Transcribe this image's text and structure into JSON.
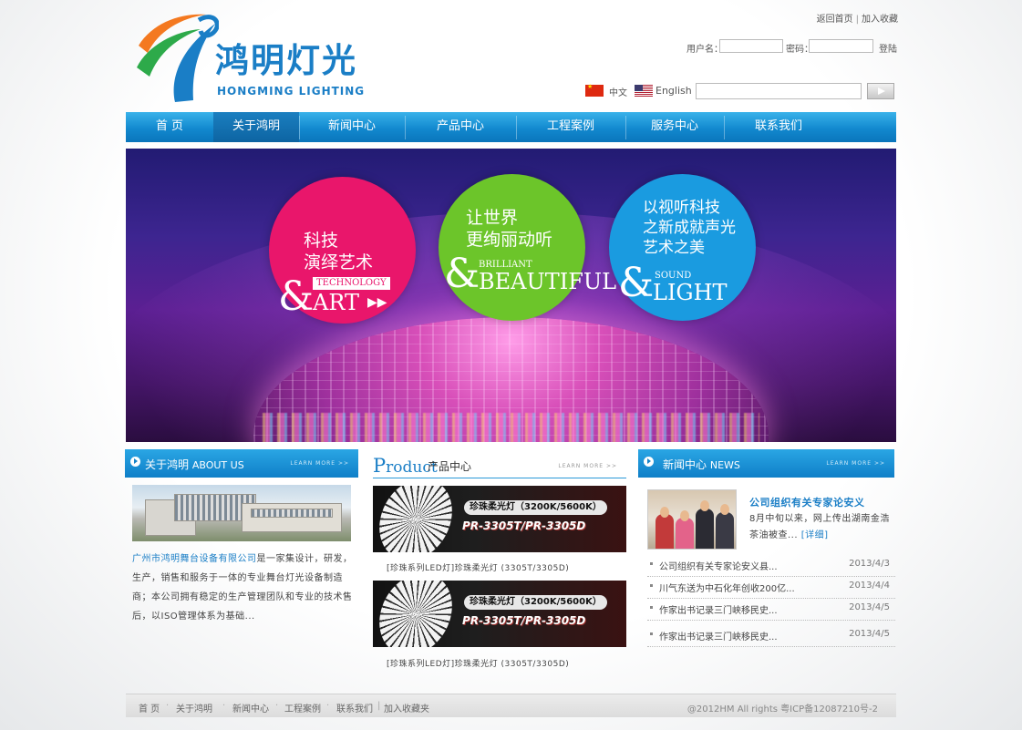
{
  "brand": {
    "name_cn": "鸿明灯光",
    "name_en": "HONGMING LIGHTING"
  },
  "toplinks": {
    "home": "返回首页",
    "bookmark": "加入收藏"
  },
  "login": {
    "username_label": "用户名：",
    "password_label": "密码：",
    "login_button": "登陆",
    "username_value": "",
    "password_value": ""
  },
  "lang": {
    "chinese": "中文",
    "english": "English"
  },
  "search": {
    "value": ""
  },
  "nav": {
    "items": [
      "首 页",
      "关于鸿明",
      "新闻中心",
      "产品中心",
      "工程案例",
      "服务中心",
      "联系我们"
    ],
    "active": "关于鸿明"
  },
  "banner": {
    "circle1": {
      "cn1": "科技",
      "cn2": "演绎艺术",
      "tag": "TECHNOLOGY",
      "big": "ART"
    },
    "circle2": {
      "cn1": "让世界",
      "cn2": "更绚丽动听",
      "small": "BRILLIANT",
      "big": "BEAUTIFUL"
    },
    "circle3": {
      "cn1": "以视听科技",
      "cn2": "之新成就声光",
      "cn3": "艺术之美",
      "small": "SOUND",
      "big": "LIGHT"
    },
    "amp": "&"
  },
  "about": {
    "title_cn": "关于鸿明",
    "title_en": "ABOUT US",
    "more": "LEARN MORE >>",
    "company": "广州市鸿明舞台设备有限公司",
    "text": "是一家集设计，研发，生产，销售和服务于一体的专业舞台灯光设备制造商；本公司拥有稳定的生产管理团队和专业的技术售后，以ISO管理体系为基础..."
  },
  "product": {
    "title_en_first": "P",
    "title_en_rest": "roduct",
    "title_cn": "产品中心",
    "more": "LEARN MORE >>",
    "items": [
      {
        "label1": "珍珠柔光灯（3200K/5600K）",
        "label2": "PR-3305T/PR-3305D",
        "caption": "[珍珠系列LED灯]珍珠柔光灯 (3305T/3305D)"
      },
      {
        "label1": "珍珠柔光灯（3200K/5600K）",
        "label2": "PR-3305T/PR-3305D",
        "caption": "[珍珠系列LED灯]珍珠柔光灯 (3305T/3305D)"
      }
    ]
  },
  "news": {
    "title_cn": "新闻中心",
    "title_en": "NEWS",
    "more": "LEARN MORE >>",
    "featured_title": "公司组织有关专家论安义",
    "featured_summary": "8月中旬以来，网上传出湖南金浩茶油被查...",
    "detail": "[详细]",
    "rows": [
      {
        "title": "公司组织有关专家论安义县...",
        "date": "2013/4/3"
      },
      {
        "title": "川气东送为中石化年创收200亿...",
        "date": "2013/4/4"
      },
      {
        "title": "作家出书记录三门峡移民史...",
        "date": "2013/4/5"
      },
      {
        "title": "作家出书记录三门峡移民史...",
        "date": "2013/4/5"
      }
    ]
  },
  "footer": {
    "links": [
      "首 页",
      "关于鸿明",
      "新闻中心",
      "工程案例",
      "联系我们",
      "加入收藏夹"
    ],
    "copyright": "@2012HM All rights 粤ICP备12087210号-2"
  },
  "colors": {
    "brand_blue": "#1a7ec6",
    "nav_blue": "#1289cf",
    "pink": "#e9166b",
    "green": "#6cc52a",
    "cyan": "#1a9be0"
  }
}
